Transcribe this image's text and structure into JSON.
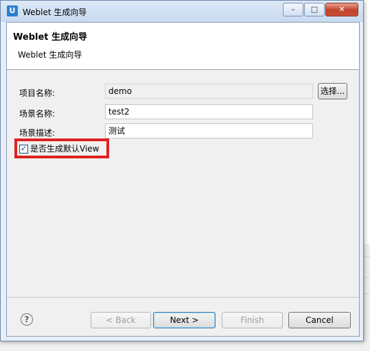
{
  "window": {
    "title": "Weblet 生成向导",
    "app_icon": "U",
    "controls": {
      "minimize": "–",
      "maximize": "□",
      "close": "✕"
    }
  },
  "banner": {
    "title": "Weblet 生成向导",
    "description": "Weblet 生成向导"
  },
  "form": {
    "project_label": "项目名称:",
    "project_value": "demo",
    "browse_label": "选择...",
    "scene_name_label": "场景名称:",
    "scene_name_value": "test2",
    "scene_desc_label": "场景描述:",
    "scene_desc_value": "测试",
    "default_view_label": "是否生成默认View",
    "default_view_checked": true,
    "check_mark": "✓"
  },
  "footer": {
    "help_icon": "?",
    "back_label": "< Back",
    "next_label": "Next >",
    "finish_label": "Finish",
    "cancel_label": "Cancel"
  },
  "colors": {
    "highlight": "#e02020",
    "close_button": "#c3422a",
    "title_bar": "#c8daf0"
  }
}
